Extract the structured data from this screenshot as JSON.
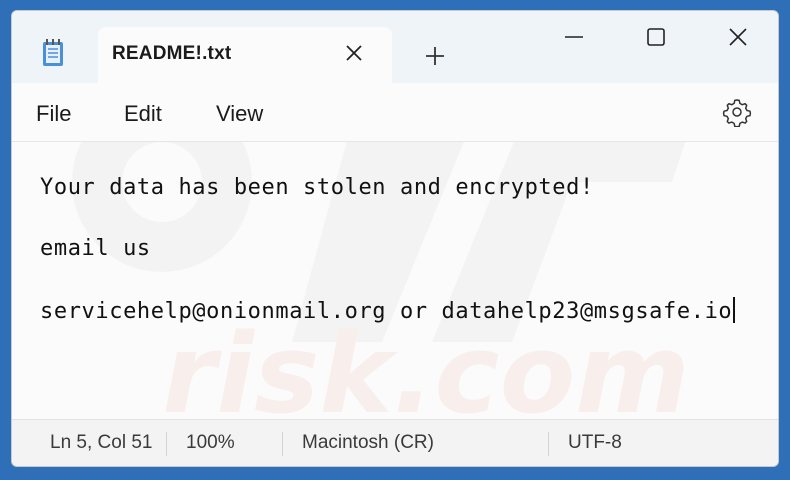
{
  "tab": {
    "title": "README!.txt"
  },
  "menu": {
    "file": "File",
    "edit": "Edit",
    "view": "View"
  },
  "icons": {
    "app": "notepad-icon",
    "close_tab": "close-icon",
    "new_tab": "plus-icon",
    "minimize": "minimize-icon",
    "maximize": "maximize-icon",
    "close_window": "close-icon",
    "settings": "gear-icon"
  },
  "editor": {
    "lines": [
      "Your data has been stolen and encrypted!",
      "email us",
      "servicehelp@onionmail.org or datahelp23@msgsafe.io"
    ]
  },
  "status": {
    "position": "Ln 5, Col 51",
    "zoom": "100%",
    "line_ending": "Macintosh (CR)",
    "encoding": "UTF-8"
  },
  "colors": {
    "background": "#2f6fb8",
    "titlebar": "#eff4f9",
    "editor": "#fbfbfb",
    "text": "#111111"
  }
}
